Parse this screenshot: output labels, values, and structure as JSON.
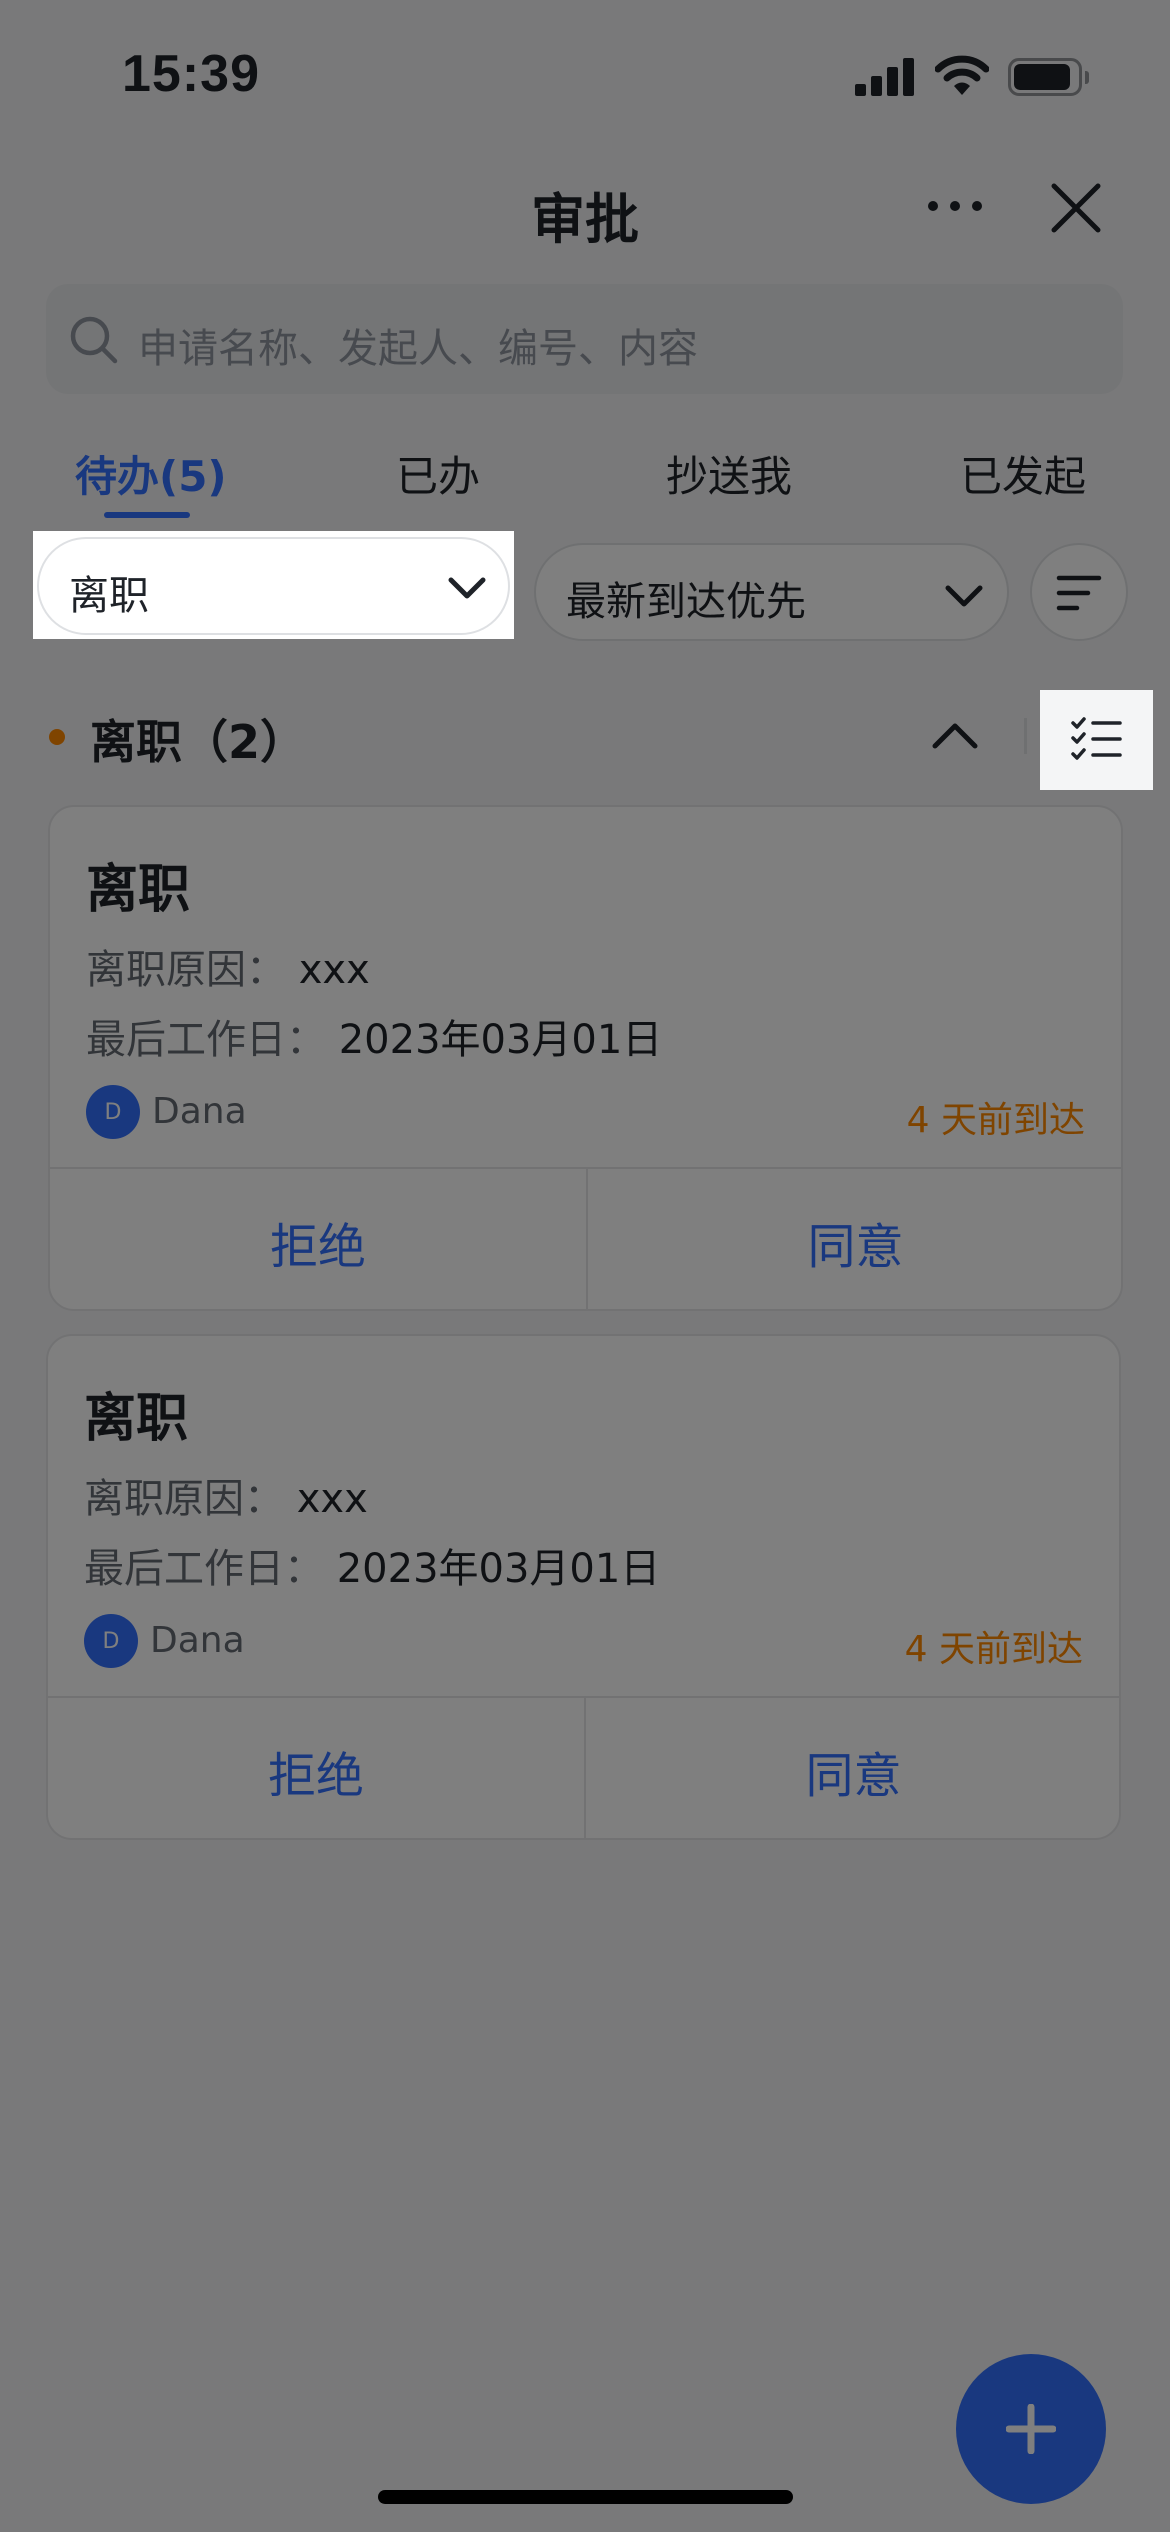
{
  "status_bar": {
    "time": "15:39"
  },
  "header": {
    "title": "审批"
  },
  "search": {
    "placeholder": "申请名称、发起人、编号、内容"
  },
  "tabs": [
    {
      "label": "待办(5)",
      "active": true
    },
    {
      "label": "已办",
      "active": false
    },
    {
      "label": "抄送我",
      "active": false
    },
    {
      "label": "已发起",
      "active": false
    }
  ],
  "filters": {
    "type_value": "离职",
    "sort_value": "最新到达优先"
  },
  "section": {
    "title": "离职（2）"
  },
  "cards": [
    {
      "title": "离职",
      "reason_label": "离职原因：",
      "reason_value": "xxx",
      "last_day_label": "最后工作日：",
      "last_day_value": "2023年03月01日",
      "avatar_initial": "D",
      "applicant": "Dana",
      "arrival": "4 天前到达",
      "reject_label": "拒绝",
      "approve_label": "同意"
    },
    {
      "title": "离职",
      "reason_label": "离职原因：",
      "reason_value": "xxx",
      "last_day_label": "最后工作日：",
      "last_day_value": "2023年03月01日",
      "avatar_initial": "D",
      "applicant": "Dana",
      "arrival": "4 天前到达",
      "reject_label": "拒绝",
      "approve_label": "同意"
    }
  ],
  "colors": {
    "accent": "#3370ff",
    "warning": "#ff8800",
    "overlay": "rgba(0,0,0,0.5)"
  },
  "icons": [
    "signal-icon",
    "wifi-icon",
    "battery-icon",
    "more-icon",
    "close-icon",
    "search-icon",
    "chevron-down-icon",
    "filter-icon",
    "chevron-up-icon",
    "batch-list-icon",
    "plus-icon"
  ]
}
